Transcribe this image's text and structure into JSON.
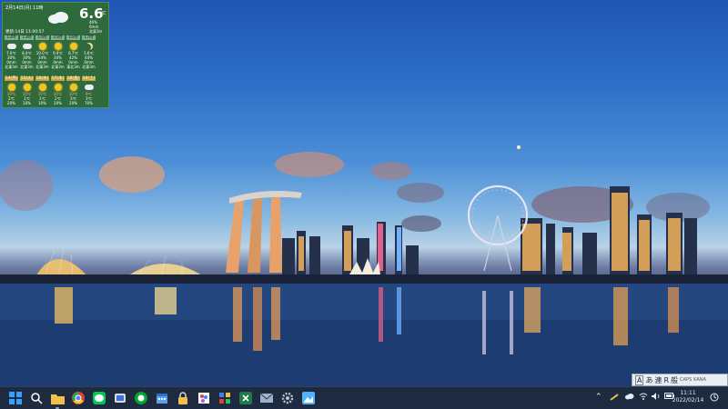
{
  "weather_widget": {
    "date": "2月14日(月) 11時",
    "temperature": "6.6",
    "unit": "℃",
    "stats": [
      "46%",
      "0mm",
      "北東3m"
    ],
    "updated": "更新:14日 11:00:57",
    "hourly": [
      {
        "hour": "12時",
        "icon": "cloud-icon",
        "temp": "7.0℃",
        "pct": "30%",
        "rain": "0mm",
        "wind": "北東3m"
      },
      {
        "hour": "13時",
        "icon": "cloud-icon",
        "temp": "8.4℃",
        "pct": "30%",
        "rain": "0mm",
        "wind": "北東3m"
      },
      {
        "hour": "14時",
        "icon": "sun-icon",
        "temp": "10.0℃",
        "pct": "34%",
        "rain": "0mm",
        "wind": "北東3m"
      },
      {
        "hour": "15時",
        "icon": "sun-icon",
        "temp": "9.4℃",
        "pct": "34%",
        "rain": "0mm",
        "wind": "北東3m"
      },
      {
        "hour": "16時",
        "icon": "sun-icon",
        "temp": "8.7℃",
        "pct": "42%",
        "rain": "0mm",
        "wind": "東北3m"
      },
      {
        "hour": "17時",
        "icon": "moon-icon",
        "temp": "5.6℃",
        "pct": "44%",
        "rain": "0mm",
        "wind": "北東3m"
      }
    ],
    "daily": [
      {
        "day": "14(月)",
        "icon": "sun-cloud-icon",
        "hi": "10℃",
        "lo": "2℃",
        "pop": "20%"
      },
      {
        "day": "15(火)",
        "icon": "sun-cloud-icon",
        "hi": "10℃",
        "lo": "1℃",
        "pop": "10%"
      },
      {
        "day": "16(水)",
        "icon": "sun-icon",
        "hi": "10℃",
        "lo": "1℃",
        "pop": "10%"
      },
      {
        "day": "17(木)",
        "icon": "sun-icon",
        "hi": "10℃",
        "lo": "2℃",
        "pop": "20%"
      },
      {
        "day": "18(金)",
        "icon": "sun-icon",
        "hi": "10℃",
        "lo": "3℃",
        "pop": "20%"
      },
      {
        "day": "19(土)",
        "icon": "cloud-sun-icon",
        "hi": "9℃",
        "lo": "3℃",
        "pop": "70%"
      }
    ]
  },
  "ime_bar": {
    "mode": "A",
    "input": "あ",
    "kanji": "連",
    "r": "R",
    "general": "般",
    "caps": "CAPS",
    "kana": "KANA"
  },
  "taskbar": {
    "pinned": [
      {
        "name": "start-icon",
        "color": "#3aa0ff"
      },
      {
        "name": "search-icon",
        "color": "#ffffff"
      },
      {
        "name": "file-explorer-icon",
        "color": "#f2c04a"
      },
      {
        "name": "chrome-icon",
        "color": "#e44133"
      },
      {
        "name": "line-icon",
        "color": "#06c755"
      },
      {
        "name": "cloud-app-icon",
        "color": "#d6dbe6"
      },
      {
        "name": "evernote-icon",
        "color": "#00a82d"
      },
      {
        "name": "calendar-icon",
        "color": "#5aa0f0"
      },
      {
        "name": "lock-icon",
        "color": "#f2c04a"
      },
      {
        "name": "paint-icon",
        "color": "#a855f7"
      },
      {
        "name": "puzzle-icon",
        "color": "#3b82f6"
      },
      {
        "name": "excel-icon",
        "color": "#1f7a45"
      },
      {
        "name": "mail-icon",
        "color": "#9fb3c8"
      },
      {
        "name": "settings-icon",
        "color": "#b7c3d1"
      },
      {
        "name": "image-app-icon",
        "color": "#4fb3ff"
      }
    ],
    "clock_time": "11:11",
    "clock_date": "2022/02/14"
  }
}
